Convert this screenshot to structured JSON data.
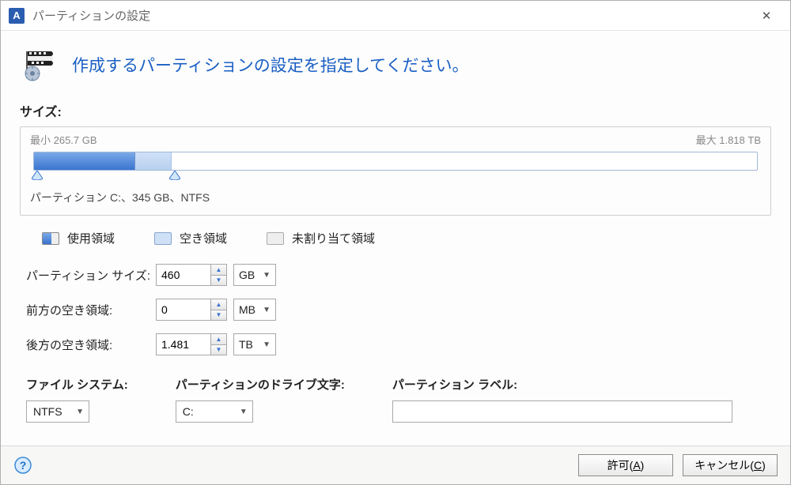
{
  "window": {
    "app_icon_letter": "A",
    "title": "パーティションの設定",
    "close_glyph": "✕"
  },
  "header": {
    "instruction": "作成するパーティションの設定を指定してください。"
  },
  "size_section": {
    "label": "サイズ:",
    "min_label": "最小 265.7 GB",
    "max_label": "最大 1.818 TB",
    "partition_info": "パーティション C:、345 GB、NTFS"
  },
  "legend": {
    "used": "使用領域",
    "free": "空き領域",
    "unallocated": "未割り当て領域"
  },
  "fields": {
    "partition_size": {
      "label": "パーティション サイズ:",
      "value": "460",
      "unit": "GB"
    },
    "space_before": {
      "label": "前方の空き領域:",
      "value": "0",
      "unit": "MB"
    },
    "space_after": {
      "label": "後方の空き領域:",
      "value": "1.481",
      "unit": "TB"
    }
  },
  "trip": {
    "filesystem": {
      "label": "ファイル システム:",
      "value": "NTFS"
    },
    "drive": {
      "label": "パーティションのドライブ文字:",
      "value": "C:"
    },
    "plabel": {
      "label": "パーティション ラベル:",
      "value": ""
    }
  },
  "footer": {
    "ok_label": "許可(",
    "ok_mnemonic": "A",
    "ok_suffix": ")",
    "cancel_label": "キャンセル(",
    "cancel_mnemonic": "C",
    "cancel_suffix": ")"
  }
}
